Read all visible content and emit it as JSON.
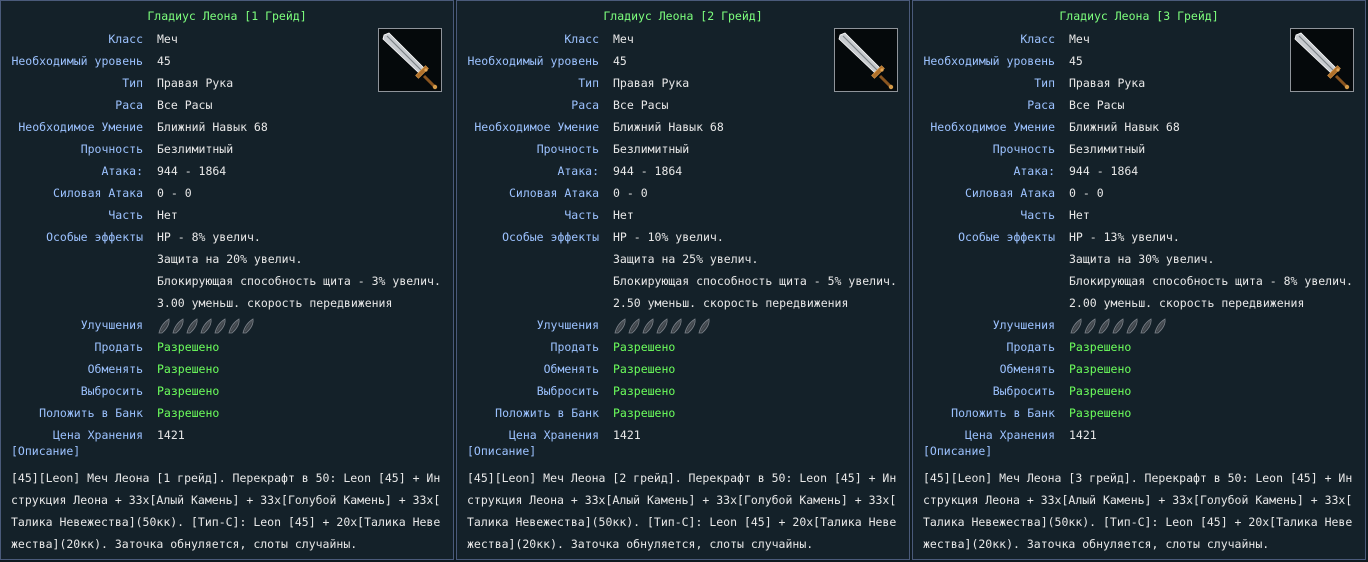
{
  "panels": [
    {
      "title": "Гладиус Леона [1 Грейд]",
      "rows": {
        "class_label": "Класс",
        "class_value": "Меч",
        "level_label": "Необходимый уровень",
        "level_value": "45",
        "type_label": "Тип",
        "type_value": "Правая Рука",
        "race_label": "Раса",
        "race_value": "Все Расы",
        "skill_label": "Необходимое Умение",
        "skill_value": "Ближний Навык 68",
        "durability_label": "Прочность",
        "durability_value": "Безлимитный",
        "attack_label": "Атака:",
        "attack_value": "944 - 1864",
        "force_label": "Силовая Атака",
        "force_value": "0 - 0",
        "part_label": "Часть",
        "part_value": "Нет",
        "effects_label": "Особые эффекты",
        "effect1": "HP - 8% увелич.",
        "effect2": "Защита на 20% увелич.",
        "effect3": "Блокирующая способность щита - 3% увелич.",
        "effect4": "3.00 уменьш. скорость передвижения",
        "upgrades_label": "Улучшения",
        "sell_label": "Продать",
        "sell_value": "Разрешено",
        "trade_label": "Обменять",
        "trade_value": "Разрешено",
        "drop_label": "Выбросить",
        "drop_value": "Разрешено",
        "bank_label": "Положить в Банк",
        "bank_value": "Разрешено",
        "storage_label": "Цена Хранения",
        "storage_value": "1421"
      },
      "description_header": "[Описание]",
      "description_lines": [
        "[45][Leon] Меч Леона [1 грейд]. Перекрафт в 50: Leon [45] + Ин",
        "струкция Леона + 33x[Алый Камень] + 33x[Голубой Камень] + 33x[",
        "Талика Невежества](50кк). [Тип-C]: Leon [45] + 20x[Талика Неве",
        "жества](20кк). Заточка обнуляется, слоты случайны."
      ]
    },
    {
      "title": "Гладиус Леона [2 Грейд]",
      "rows": {
        "class_label": "Класс",
        "class_value": "Меч",
        "level_label": "Необходимый уровень",
        "level_value": "45",
        "type_label": "Тип",
        "type_value": "Правая Рука",
        "race_label": "Раса",
        "race_value": "Все Расы",
        "skill_label": "Необходимое Умение",
        "skill_value": "Ближний Навык 68",
        "durability_label": "Прочность",
        "durability_value": "Безлимитный",
        "attack_label": "Атака:",
        "attack_value": "944 - 1864",
        "force_label": "Силовая Атака",
        "force_value": "0 - 0",
        "part_label": "Часть",
        "part_value": "Нет",
        "effects_label": "Особые эффекты",
        "effect1": "HP - 10% увелич.",
        "effect2": "Защита на 25% увелич.",
        "effect3": "Блокирующая способность щита - 5% увелич.",
        "effect4": "2.50 уменьш. скорость передвижения",
        "upgrades_label": "Улучшения",
        "sell_label": "Продать",
        "sell_value": "Разрешено",
        "trade_label": "Обменять",
        "trade_value": "Разрешено",
        "drop_label": "Выбросить",
        "drop_value": "Разрешено",
        "bank_label": "Положить в Банк",
        "bank_value": "Разрешено",
        "storage_label": "Цена Хранения",
        "storage_value": "1421"
      },
      "description_header": "[Описание]",
      "description_lines": [
        "[45][Leon] Меч Леона [2 грейд]. Перекрафт в 50: Leon [45] + Ин",
        "струкция Леона + 33x[Алый Камень] + 33x[Голубой Камень] + 33x[",
        "Талика Невежества](50кк). [Тип-C]: Leon [45] + 20x[Талика Неве",
        "жества](20кк). Заточка обнуляется, слоты случайны."
      ]
    },
    {
      "title": "Гладиус Леона [3 Грейд]",
      "rows": {
        "class_label": "Класс",
        "class_value": "Меч",
        "level_label": "Необходимый уровень",
        "level_value": "45",
        "type_label": "Тип",
        "type_value": "Правая Рука",
        "race_label": "Раса",
        "race_value": "Все Расы",
        "skill_label": "Необходимое Умение",
        "skill_value": "Ближний Навык 68",
        "durability_label": "Прочность",
        "durability_value": "Безлимитный",
        "attack_label": "Атака:",
        "attack_value": "944 - 1864",
        "force_label": "Силовая Атака",
        "force_value": "0 - 0",
        "part_label": "Часть",
        "part_value": "Нет",
        "effects_label": "Особые эффекты",
        "effect1": "HP - 13% увелич.",
        "effect2": "Защита на 30% увелич.",
        "effect3": "Блокирующая способность щита - 8% увелич.",
        "effect4": "2.00 уменьш. скорость передвижения",
        "upgrades_label": "Улучшения",
        "sell_label": "Продать",
        "sell_value": "Разрешено",
        "trade_label": "Обменять",
        "trade_value": "Разрешено",
        "drop_label": "Выбросить",
        "drop_value": "Разрешено",
        "bank_label": "Положить в Банк",
        "bank_value": "Разрешено",
        "storage_label": "Цена Хранения",
        "storage_value": "1421"
      },
      "description_header": "[Описание]",
      "description_lines": [
        "[45][Leon] Меч Леона [3 грейд]. Перекрафт в 50: Leon [45] + Ин",
        "струкция Леона + 33x[Алый Камень] + 33x[Голубой Камень] + 33x[",
        "Талика Невежества](50кк). [Тип-C]: Leon [45] + 20x[Талика Неве",
        "жества](20кк). Заточка обнуляется, слоты случайны."
      ]
    }
  ],
  "item_icon": "sword-icon",
  "upgrade_slot_icon": "empty-upgrade-slot-icon",
  "upgrade_slot_count": 7,
  "colors": {
    "title": "#7dff7d",
    "label": "#9cc2ff",
    "value": "#e8e8e8",
    "allowed": "#6cff5c",
    "background": "#142129",
    "border": "#4a5a7a"
  }
}
